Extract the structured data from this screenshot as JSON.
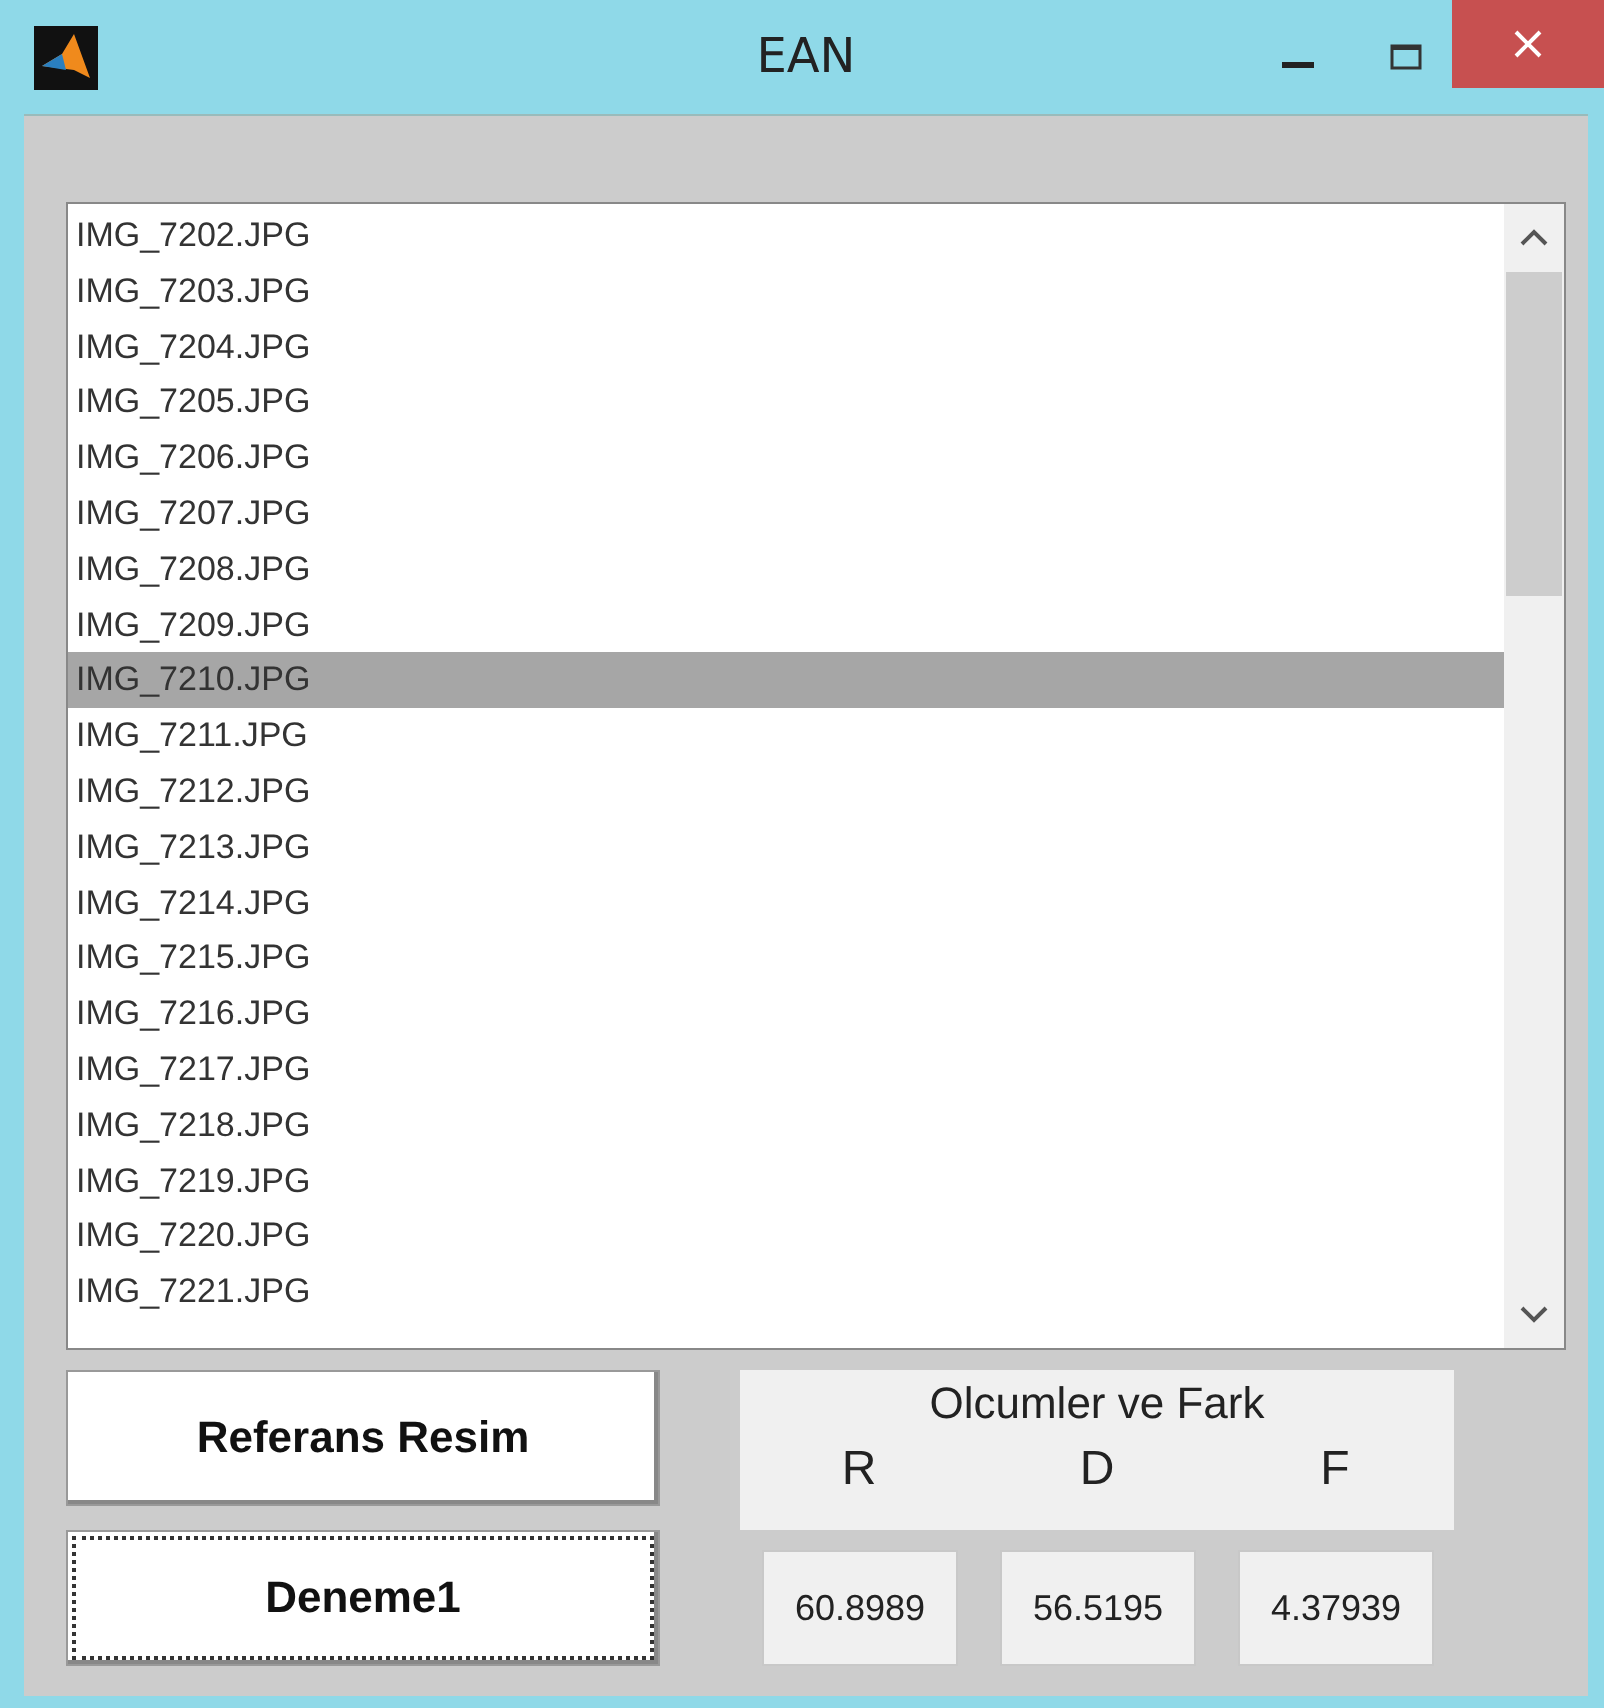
{
  "window": {
    "title": "EAN"
  },
  "file_list": {
    "items": [
      {
        "label": "IMG_7202.JPG",
        "selected": false
      },
      {
        "label": "IMG_7203.JPG",
        "selected": false
      },
      {
        "label": "IMG_7204.JPG",
        "selected": false
      },
      {
        "label": "IMG_7205.JPG",
        "selected": false
      },
      {
        "label": "IMG_7206.JPG",
        "selected": false
      },
      {
        "label": "IMG_7207.JPG",
        "selected": false
      },
      {
        "label": "IMG_7208.JPG",
        "selected": false
      },
      {
        "label": "IMG_7209.JPG",
        "selected": false
      },
      {
        "label": "IMG_7210.JPG",
        "selected": true
      },
      {
        "label": "IMG_7211.JPG",
        "selected": false
      },
      {
        "label": "IMG_7212.JPG",
        "selected": false
      },
      {
        "label": "IMG_7213.JPG",
        "selected": false
      },
      {
        "label": "IMG_7214.JPG",
        "selected": false
      },
      {
        "label": "IMG_7215.JPG",
        "selected": false
      },
      {
        "label": "IMG_7216.JPG",
        "selected": false
      },
      {
        "label": "IMG_7217.JPG",
        "selected": false
      },
      {
        "label": "IMG_7218.JPG",
        "selected": false
      },
      {
        "label": "IMG_7219.JPG",
        "selected": false
      },
      {
        "label": "IMG_7220.JPG",
        "selected": false
      },
      {
        "label": "IMG_7221.JPG",
        "selected": false
      }
    ]
  },
  "buttons": [
    {
      "label": "Referans Resim",
      "focused": false
    },
    {
      "label": "Deneme1",
      "focused": true
    }
  ],
  "measurements": {
    "title": "Olcumler ve Fark",
    "columns": [
      "R",
      "D",
      "F"
    ],
    "values": [
      "60.8989",
      "56.5195",
      "4.37939"
    ]
  }
}
